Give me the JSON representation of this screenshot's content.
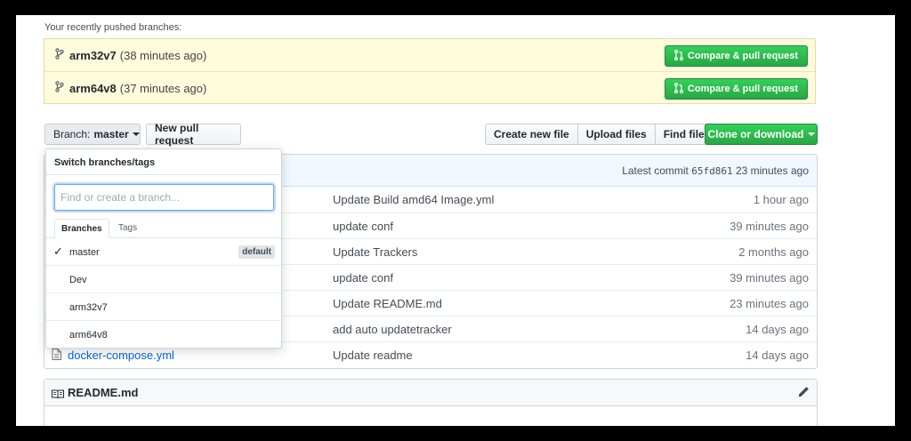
{
  "recent": {
    "title": "Your recently pushed branches:",
    "branches": [
      {
        "name": "arm32v7",
        "time": "(38 minutes ago)",
        "button": "Compare & pull request"
      },
      {
        "name": "arm64v8",
        "time": "(37 minutes ago)",
        "button": "Compare & pull request"
      }
    ]
  },
  "toolbar": {
    "branch_prefix": "Branch:",
    "branch_value": "master",
    "new_pr": "New pull request",
    "create_file": "Create new file",
    "upload_files": "Upload files",
    "find_file": "Find file",
    "clone": "Clone or download"
  },
  "commit": {
    "label": "Latest commit",
    "sha": "65fd861",
    "time": "23 minutes ago"
  },
  "files": [
    {
      "name": "",
      "message": "Update Build amd64 Image.yml",
      "age": "1 hour ago"
    },
    {
      "name": "",
      "message": "update conf",
      "age": "39 minutes ago"
    },
    {
      "name": "",
      "message": "Update Trackers",
      "age": "2 months ago"
    },
    {
      "name": "",
      "message": "update conf",
      "age": "39 minutes ago"
    },
    {
      "name": "",
      "message": "Update README.md",
      "age": "23 minutes ago"
    },
    {
      "name": "",
      "message": "add auto updatetracker",
      "age": "14 days ago"
    },
    {
      "name": "docker-compose.yml",
      "message": "Update readme",
      "age": "14 days ago"
    }
  ],
  "readme": {
    "title": "README.md"
  },
  "dropdown": {
    "title": "Switch branches/tags",
    "placeholder": "Find or create a branch...",
    "tabs": [
      "Branches",
      "Tags"
    ],
    "items": [
      {
        "name": "master",
        "selected": true,
        "badge": "default"
      },
      {
        "name": "Dev"
      },
      {
        "name": "arm32v7"
      },
      {
        "name": "arm64v8"
      }
    ]
  },
  "icons": {
    "branch": "git-branch-icon",
    "pull_request": "git-pull-request-icon",
    "file": "file-icon",
    "book": "book-icon",
    "pencil": "pencil-icon",
    "check": "check-icon"
  },
  "colors": {
    "green": "#28a745",
    "banner": "#fffbdd",
    "link": "#0366d6",
    "commit_bar": "#f1f8ff"
  }
}
